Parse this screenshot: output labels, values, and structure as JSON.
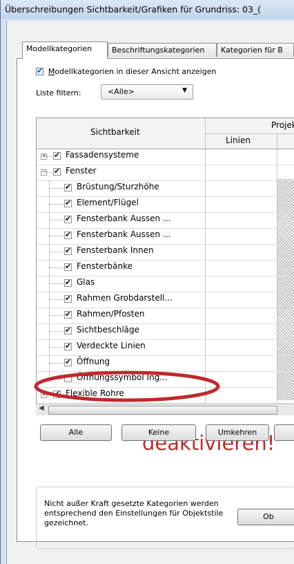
{
  "window": {
    "title": "Überschreibungen Sichtbarkeit/Grafiken für Grundriss: 03_("
  },
  "tabs": [
    {
      "label": "Modellkategorien",
      "active": true
    },
    {
      "label": "Beschriftungskategorien",
      "active": false
    },
    {
      "label": "Kategorien für B",
      "active": false
    }
  ],
  "show_model_categories": {
    "label": "Modellkategorien in dieser Ansicht anzeigen",
    "checked": true
  },
  "filter": {
    "label": "Liste filtern:",
    "value": "<Alle>"
  },
  "grid": {
    "header_visibility": "Sichtbarkeit",
    "header_projection": "Projekt",
    "header_lines": "Linien",
    "rows": [
      {
        "label": "Fassadensysteme",
        "level": 0,
        "expander": "+",
        "checked": true
      },
      {
        "label": "Fenster",
        "level": 0,
        "expander": "−",
        "checked": true
      },
      {
        "label": "Brüstung/Sturzhöhe",
        "level": 1,
        "checked": true
      },
      {
        "label": "Element/Flügel",
        "level": 1,
        "checked": true
      },
      {
        "label": "Fensterbank Aussen ...",
        "level": 1,
        "checked": true
      },
      {
        "label": "Fensterbank Aussen ...",
        "level": 1,
        "checked": true
      },
      {
        "label": "Fensterbank Innen",
        "level": 1,
        "checked": true
      },
      {
        "label": "Fensterbänke",
        "level": 1,
        "checked": true
      },
      {
        "label": "Glas",
        "level": 1,
        "checked": true
      },
      {
        "label": "Rahmen Grobdarstell...",
        "level": 1,
        "checked": true
      },
      {
        "label": "Rahmen/Pfosten",
        "level": 1,
        "checked": true
      },
      {
        "label": "Sichtbeschläge",
        "level": 1,
        "checked": true
      },
      {
        "label": "Verdeckte Linien",
        "level": 1,
        "checked": true
      },
      {
        "label": "Öffnung",
        "level": 1,
        "checked": true
      },
      {
        "label": "Öffnungssymbol Ing...",
        "level": 1,
        "checked": false
      },
      {
        "label": "Flexible Rohre",
        "level": 0,
        "expander": "+",
        "checked": true
      }
    ]
  },
  "buttons": {
    "all": "Alle",
    "none": "Keine",
    "invert": "Umkehren",
    "ok_partial": "Ob"
  },
  "annotation": "deaktivieren!",
  "note": "Nicht außer Kraft gesetzte Kategorien werden entsprechend den Einstellungen für Objektstile gezeichnet.",
  "colors": {
    "annotation_red": "#c0292b",
    "window_frame": "#d6e3f0"
  }
}
